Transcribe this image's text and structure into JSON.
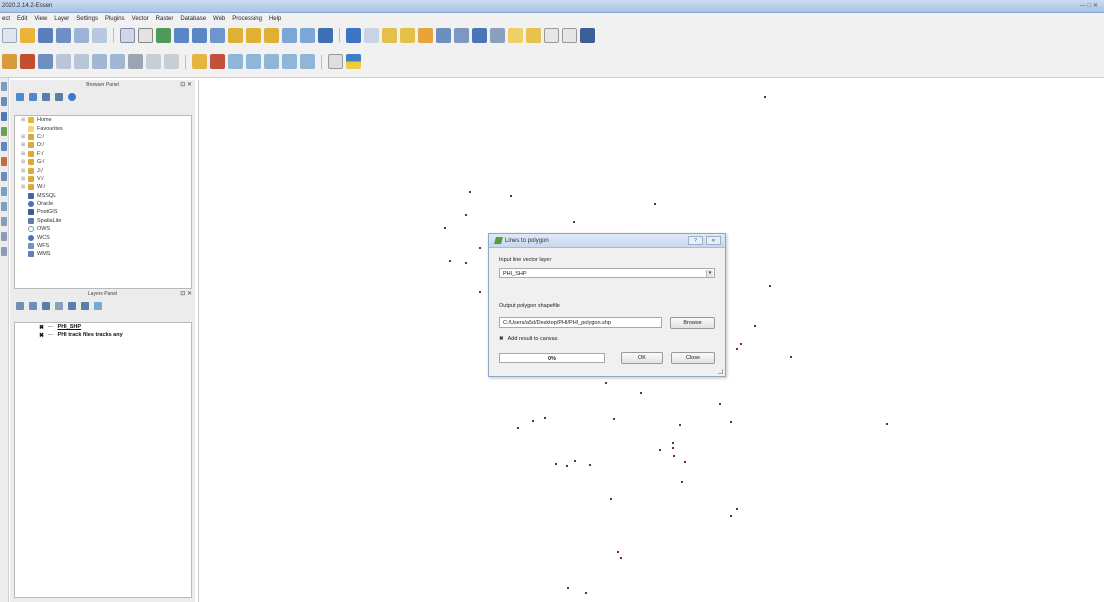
{
  "window": {
    "title": "2020.2.14.2-Essen",
    "controls": "— □ ✕"
  },
  "menu": [
    "ect",
    "Edit",
    "View",
    "Layer",
    "Settings",
    "Plugins",
    "Vector",
    "Raster",
    "Database",
    "Web",
    "Processing",
    "Help"
  ],
  "browser_panel": {
    "title": "Browser Panel",
    "controls": "⊡ ✕",
    "items": [
      {
        "label": "Home",
        "icon": "home-folder-icon"
      },
      {
        "label": "Favourites",
        "icon": "star-icon"
      },
      {
        "label": "C:/",
        "icon": "drive-icon"
      },
      {
        "label": "D:/",
        "icon": "drive-icon"
      },
      {
        "label": "F:/",
        "icon": "drive-icon"
      },
      {
        "label": "G:/",
        "icon": "drive-icon"
      },
      {
        "label": "J:/",
        "icon": "drive-icon"
      },
      {
        "label": "V:/",
        "icon": "drive-icon"
      },
      {
        "label": "W:/",
        "icon": "drive-icon"
      },
      {
        "label": "MSSQL",
        "icon": "mssql-icon"
      },
      {
        "label": "Oracle",
        "icon": "oracle-icon"
      },
      {
        "label": "PostGIS",
        "icon": "postgis-icon"
      },
      {
        "label": "SpatiaLite",
        "icon": "spatialite-icon"
      },
      {
        "label": "OWS",
        "icon": "ows-icon"
      },
      {
        "label": "WCS",
        "icon": "wcs-icon"
      },
      {
        "label": "WFS",
        "icon": "wfs-icon"
      },
      {
        "label": "WMS",
        "icon": "wms-icon"
      }
    ]
  },
  "layers_panel": {
    "title": "Layers Panel",
    "controls": "⊡ ✕",
    "layers": [
      {
        "name": "PHI_SHP",
        "checked": "✖"
      },
      {
        "name": "PHI track files tracks any",
        "checked": "✖"
      }
    ]
  },
  "dialog": {
    "title": "Lines to polygon",
    "help_label": "? ",
    "close_label": "✕",
    "input_label": "Input line vector layer",
    "input_value": "PHI_SHP",
    "output_label": "Output polygon shapefile",
    "output_value": "C:/Users/a5d/Desktop/PHI/PHI_polygon.shp",
    "browse_label": "Browse",
    "add_result_label": "Add result to canvas",
    "add_result_checked": "✖",
    "progress_text": "0%",
    "progress_value": 0,
    "ok_label": "OK",
    "close_button_label": "Close"
  },
  "colors": {
    "canvas_points": "#7b2a3a",
    "progress_fill": "#6bbf4a"
  }
}
